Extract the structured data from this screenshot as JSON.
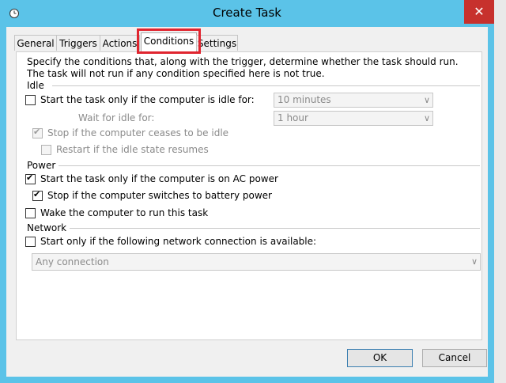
{
  "window": {
    "title": "Create Task",
    "close_glyph": "✕"
  },
  "tabs": [
    {
      "label": "General"
    },
    {
      "label": "Triggers"
    },
    {
      "label": "Actions"
    },
    {
      "label": "Conditions"
    },
    {
      "label": "Settings"
    }
  ],
  "selected_tab": "Conditions",
  "description": "Specify the conditions that, along with the trigger, determine whether the task should run.  The task will not run  if any condition specified here is not true.",
  "idle": {
    "heading": "Idle",
    "start_only_if_idle": {
      "label": "Start the task only if the computer is idle for:",
      "checked": false
    },
    "idle_for": {
      "value": "10 minutes"
    },
    "wait_label": "Wait for idle for:",
    "wait_for": {
      "value": "1 hour"
    },
    "stop_if_ceases": {
      "label": "Stop if the computer ceases to be idle",
      "checked": true,
      "enabled": false
    },
    "restart_if_resumes": {
      "label": "Restart if the idle state resumes",
      "checked": false,
      "enabled": false
    }
  },
  "power": {
    "heading": "Power",
    "ac_power": {
      "label": "Start the task only if the computer is on AC power",
      "checked": true
    },
    "battery": {
      "label": "Stop if the computer switches to battery power",
      "checked": true
    },
    "wake": {
      "label": "Wake the computer to run this task",
      "checked": false
    }
  },
  "network": {
    "heading": "Network",
    "only_if_network": {
      "label": "Start only if the following network connection is available:",
      "checked": false
    },
    "connection": {
      "value": "Any connection"
    }
  },
  "buttons": {
    "ok": "OK",
    "cancel": "Cancel"
  },
  "colors": {
    "titlebar": "#5bc3e8",
    "close": "#c7312d",
    "highlight": "#e0252f"
  }
}
